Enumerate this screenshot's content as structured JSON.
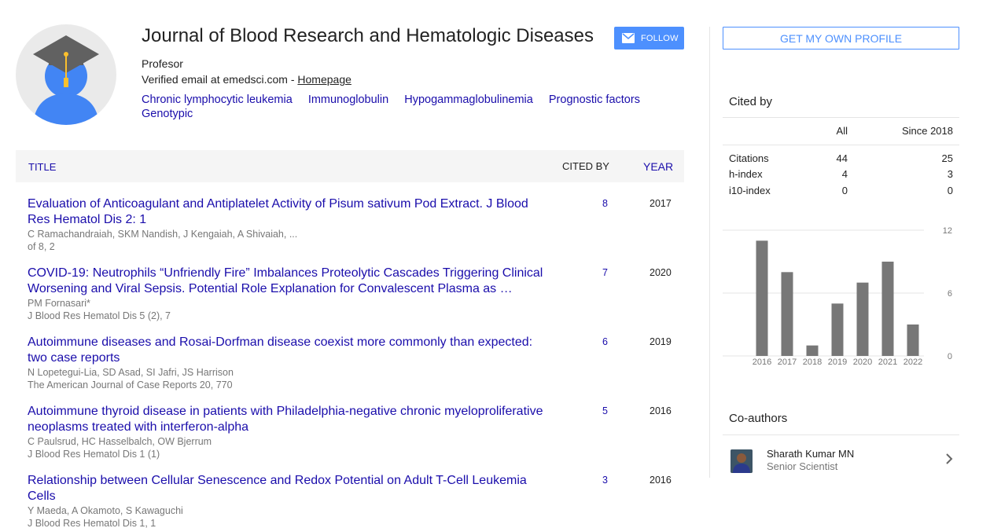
{
  "profile": {
    "name": "Journal of Blood Research and Hematologic Diseases",
    "affiliation": "Profesor",
    "verified_prefix": "Verified email at emedsci.com - ",
    "homepage_label": "Homepage",
    "interests": [
      "Chronic lymphocytic leukemia",
      "Immunoglobulin",
      "Hypogammaglobulinemia",
      "Prognostic factors",
      "Genotypic"
    ],
    "follow_label": "FOLLOW"
  },
  "table": {
    "col_title": "TITLE",
    "col_cited": "CITED BY",
    "col_year": "YEAR",
    "rows": [
      {
        "title": "Evaluation of Anticoagulant and Antiplatelet Activity of Pisum sativum Pod Extract. J Blood Res Hematol Dis 2: 1",
        "authors": "C Ramachandraiah, SKM Nandish, J Kengaiah, A Shivaiah, ...",
        "venue": "of 8, 2",
        "cited": "8",
        "year": "2017"
      },
      {
        "title": "COVID-19: Neutrophils “Unfriendly Fire” Imbalances Proteolytic Cascades Triggering Clinical Worsening and Viral Sepsis. Potential Role Explanation for Convalescent Plasma as …",
        "authors": "PM Fornasari*",
        "venue": "J Blood Res Hematol Dis 5 (2), 7",
        "cited": "7",
        "year": "2020"
      },
      {
        "title": "Autoimmune diseases and Rosai-Dorfman disease coexist more commonly than expected: two case reports",
        "authors": "N Lopetegui-Lia, SD Asad, SI Jafri, JS Harrison",
        "venue": "The American Journal of Case Reports 20, 770",
        "cited": "6",
        "year": "2019"
      },
      {
        "title": "Autoimmune thyroid disease in patients with Philadelphia-negative chronic myeloproliferative neoplasms treated with interferon-alpha",
        "authors": "C Paulsrud, HC Hasselbalch, OW Bjerrum",
        "venue": "J Blood Res Hematol Dis 1 (1)",
        "cited": "5",
        "year": "2016"
      },
      {
        "title": "Relationship between Cellular Senescence and Redox Potential on Adult T-Cell Leukemia Cells",
        "authors": "Y Maeda, A Okamoto, S Kawaguchi",
        "venue": "J Blood Res Hematol Dis 1, 1",
        "cited": "3",
        "year": "2016"
      }
    ]
  },
  "sidebar": {
    "profile_button": "GET MY OWN PROFILE",
    "cited_by_title": "Cited by",
    "stats_header": {
      "all": "All",
      "since": "Since 2018"
    },
    "stats": [
      {
        "label": "Citations",
        "all": "44",
        "since": "25"
      },
      {
        "label": "h-index",
        "all": "4",
        "since": "3"
      },
      {
        "label": "i10-index",
        "all": "0",
        "since": "0"
      }
    ],
    "coauthors_title": "Co-authors",
    "coauthors": [
      {
        "name": "Sharath Kumar MN",
        "affiliation": "Senior Scientist"
      }
    ]
  },
  "chart_data": {
    "type": "bar",
    "categories": [
      "2016",
      "2017",
      "2018",
      "2019",
      "2020",
      "2021",
      "2022"
    ],
    "values": [
      11,
      8,
      1,
      5,
      7,
      9,
      3
    ],
    "ylim": [
      0,
      12
    ],
    "yticks": [
      "12",
      "6",
      "0"
    ],
    "grid": true,
    "bar_color": "#777777"
  }
}
